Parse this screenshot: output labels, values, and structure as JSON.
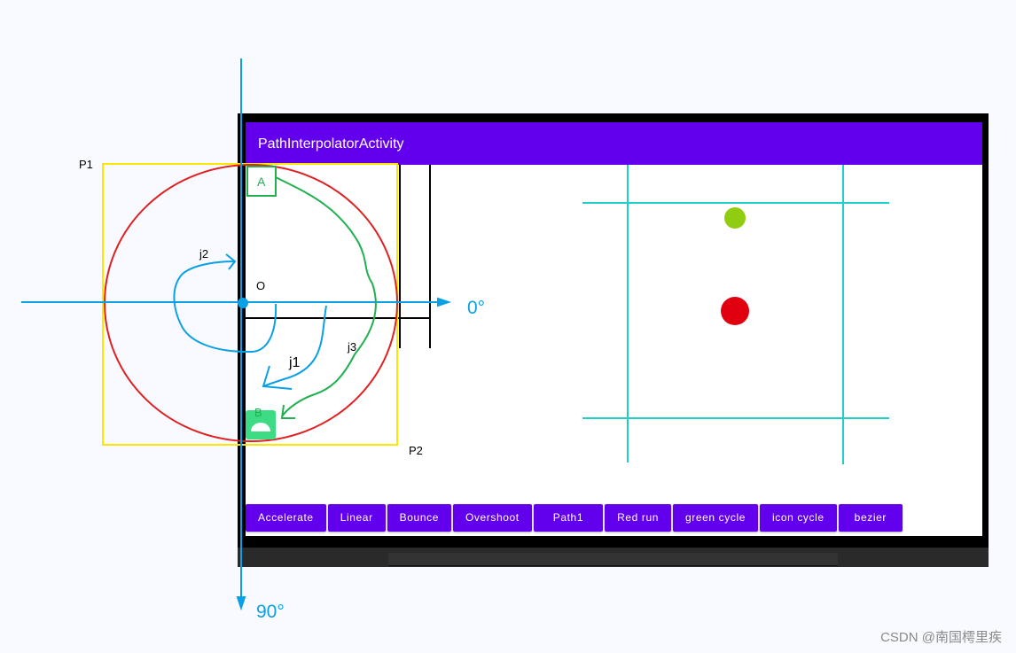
{
  "app": {
    "title": "PathInterpolatorActivity",
    "buttons": [
      "Accelerate",
      "Linear",
      "Bounce",
      "Overshoot",
      "Path1",
      "Red run",
      "green cycle",
      "icon cycle",
      "bezier"
    ]
  },
  "annotations": {
    "p1": "P1",
    "p2": "P2",
    "origin": "O",
    "a": "A",
    "b": "B",
    "j1": "j1",
    "j2": "j2",
    "j3": "j3",
    "angle_0": "0°",
    "angle_90": "90°"
  },
  "watermark": "CSDN @南国樗里疾",
  "colors": {
    "app_bar": "#6200ee",
    "axis": "#0aa0e6",
    "circle": "#e02020",
    "bounding_box": "#ffe600",
    "green_path": "#20b050",
    "grid_lines": "#20d0c8",
    "green_ball": "#90cc10",
    "red_ball": "#e00010"
  }
}
